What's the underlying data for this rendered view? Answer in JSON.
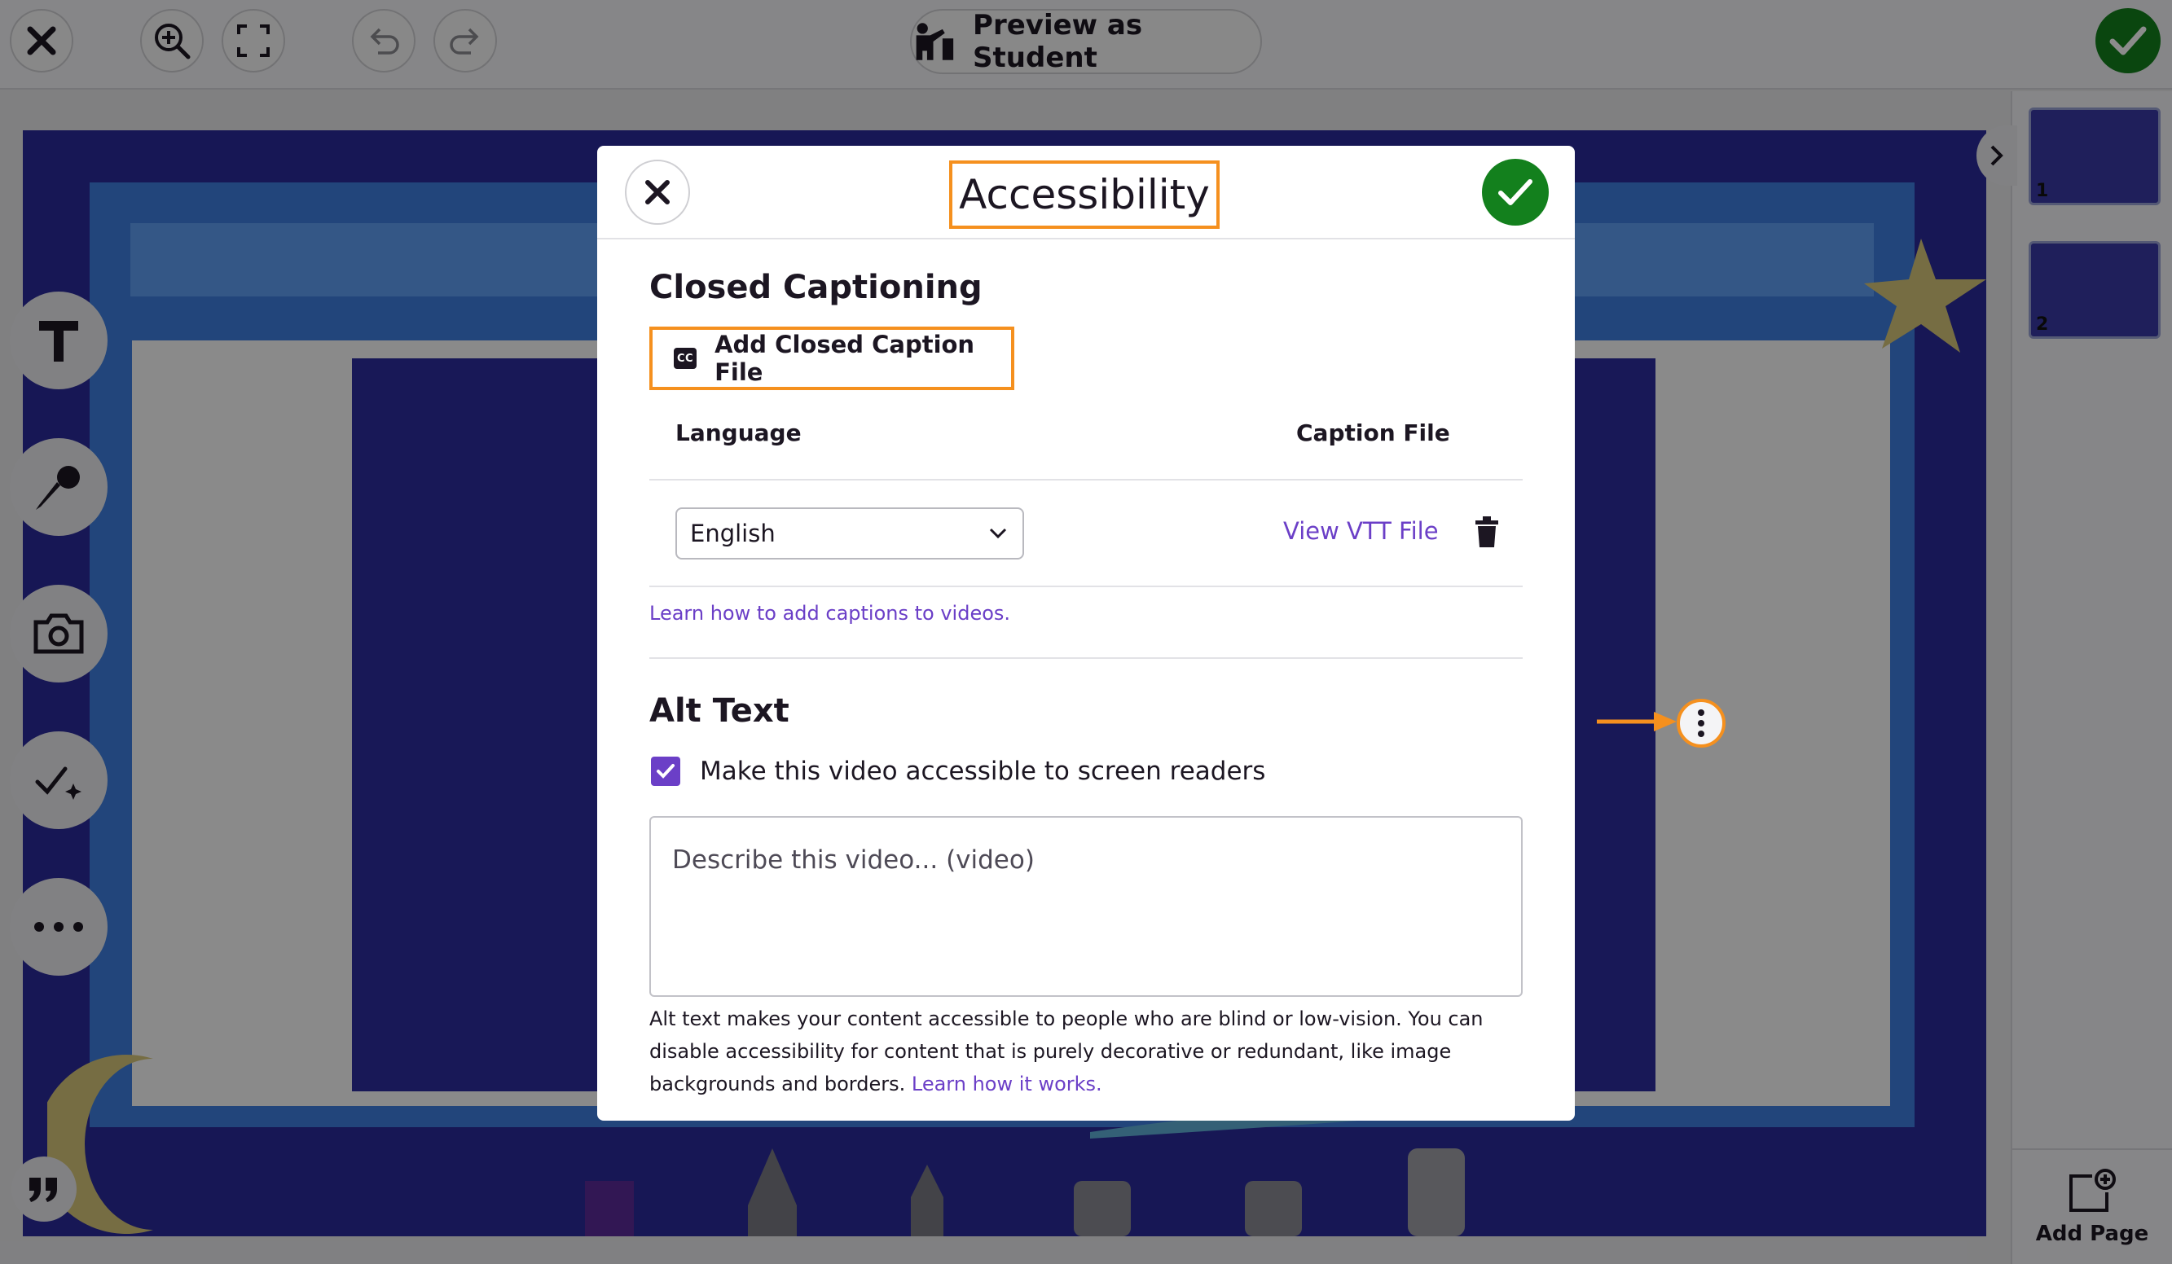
{
  "toolbar": {
    "preview_label": "Preview as Student"
  },
  "modal": {
    "title": "Accessibility",
    "closed_captioning": {
      "heading": "Closed Captioning",
      "cc_glyph": "CC",
      "add_button_label": "Add Closed Caption File",
      "col_language": "Language",
      "col_caption_file": "Caption File",
      "selected_language": "English",
      "view_vtt_label": "View VTT File",
      "learn_link": "Learn how to add captions to videos."
    },
    "alt_text": {
      "heading": "Alt Text",
      "checkbox_label": "Make this video accessible to screen readers",
      "checkbox_checked": true,
      "placeholder": "Describe this video... (video)",
      "help_text": "Alt text makes your content accessible to people who are blind or low-vision. You can disable accessibility for content that is purely decorative or redundant, like image backgrounds and borders.",
      "help_link": "Learn how it works."
    }
  },
  "pages": {
    "thumbs": [
      {
        "number": "1"
      },
      {
        "number": "2"
      }
    ],
    "add_page_label": "Add Page"
  },
  "colors": {
    "accent_orange": "#f5901e",
    "success_green": "#13801d",
    "link_purple": "#6b3fc7"
  },
  "icons": {
    "top_left": [
      "close-icon",
      "zoom-in-icon",
      "fullscreen-icon",
      "undo-icon",
      "redo-icon"
    ],
    "preview": "student-presenter-icon",
    "side_tools": [
      "text-icon",
      "microphone-icon",
      "camera-icon",
      "sparkle-check-icon",
      "more-icon",
      "quote-icon"
    ]
  }
}
